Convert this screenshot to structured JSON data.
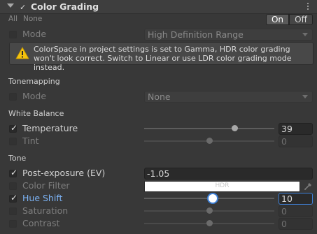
{
  "header": {
    "title": "Color Grading",
    "enabled": true
  },
  "toolbar": {
    "all_label": "All",
    "none_label": "None",
    "on_label": "On",
    "off_label": "Off"
  },
  "mode": {
    "label": "Mode",
    "value": "High Definition Range"
  },
  "warning": {
    "icon": "warning-icon",
    "text": "ColorSpace in project settings is set to Gamma, HDR color grading won't look correct. Switch to Linear or use LDR color grading mode instead."
  },
  "tonemapping": {
    "section_label": "Tonemapping",
    "mode_label": "Mode",
    "mode_value": "None"
  },
  "white_balance": {
    "section_label": "White Balance",
    "temperature": {
      "label": "Temperature",
      "value": "39",
      "fraction": 0.695,
      "enabled": true
    },
    "tint": {
      "label": "Tint",
      "value": "0",
      "fraction": 0.5,
      "enabled": false
    }
  },
  "tone": {
    "section_label": "Tone",
    "post_exposure": {
      "label": "Post-exposure (EV)",
      "value": "-1.05",
      "enabled": true
    },
    "color_filter": {
      "label": "Color Filter",
      "hdr_label": "HDR",
      "color": "#ffffff",
      "enabled": false
    },
    "hue_shift": {
      "label": "Hue Shift",
      "value": "10",
      "fraction": 0.528,
      "enabled": true
    },
    "saturation": {
      "label": "Saturation",
      "value": "0",
      "fraction": 0.5,
      "enabled": false
    },
    "contrast": {
      "label": "Contrast",
      "value": "0",
      "fraction": 0.5,
      "enabled": false
    }
  },
  "colors": {
    "accent": "#3d7fd6",
    "active_label": "#7cb3f5",
    "background": "#383838"
  }
}
